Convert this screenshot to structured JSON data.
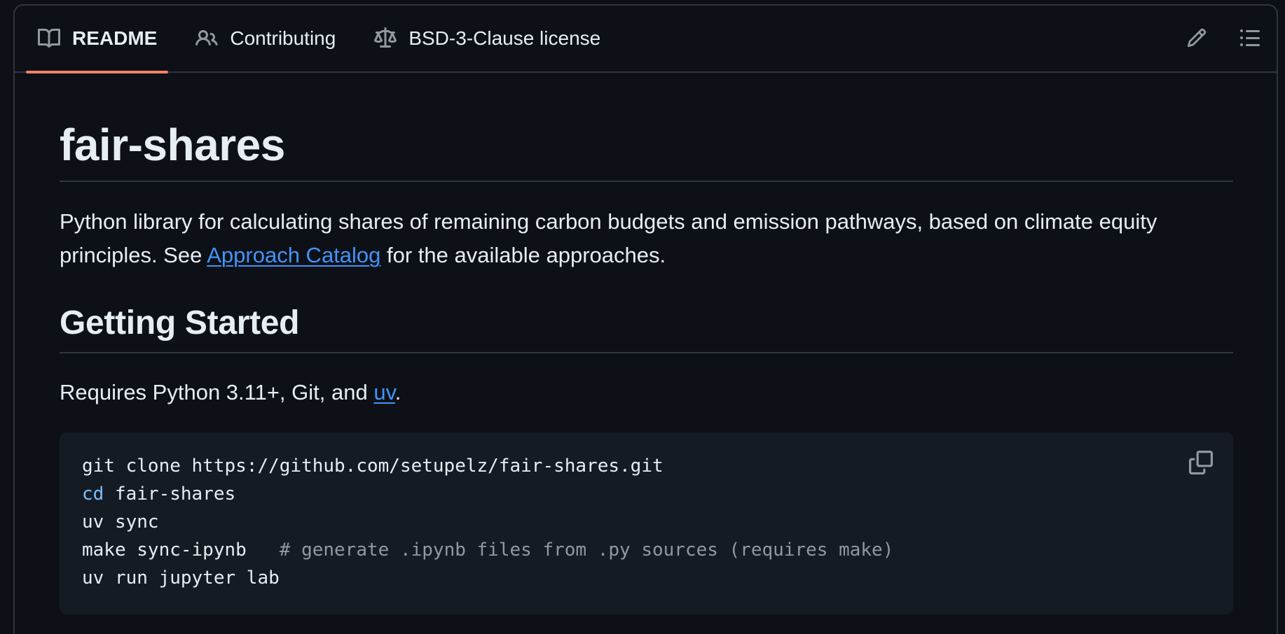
{
  "tabs": [
    {
      "label": "README",
      "icon": "book-icon",
      "active": true
    },
    {
      "label": "Contributing",
      "icon": "people-icon",
      "active": false
    },
    {
      "label": "BSD-3-Clause license",
      "icon": "law-icon",
      "active": false
    }
  ],
  "actions": {
    "edit_icon": "pencil-icon",
    "outline_icon": "list-icon"
  },
  "readme": {
    "title": "fair-shares",
    "description_before": "Python library for calculating shares of remaining carbon budgets and emission pathways, based on climate equity principles. See ",
    "description_link": "Approach Catalog",
    "description_after": " for the available approaches.",
    "section_heading": "Getting Started",
    "requires_before": "Requires Python 3.11+, Git, and ",
    "requires_link": "uv",
    "requires_after": "."
  },
  "code": {
    "line1": "git clone https://github.com/setupelz/fair-shares.git",
    "line2_kw": "cd",
    "line2_rest": " fair-shares",
    "line3": "uv sync",
    "line4_cmd": "make sync-ipynb   ",
    "line4_comment": "# generate .ipynb files from .py sources (requires make)",
    "line5": "uv run jupyter lab",
    "copy_icon": "copy-icon"
  },
  "colors": {
    "background": "#0d1117",
    "border": "#30363d",
    "accent_underline": "#f78166",
    "link": "#4493f8",
    "code_bg": "#151b23",
    "code_keyword": "#79c0ff",
    "code_comment": "#9198a1"
  }
}
